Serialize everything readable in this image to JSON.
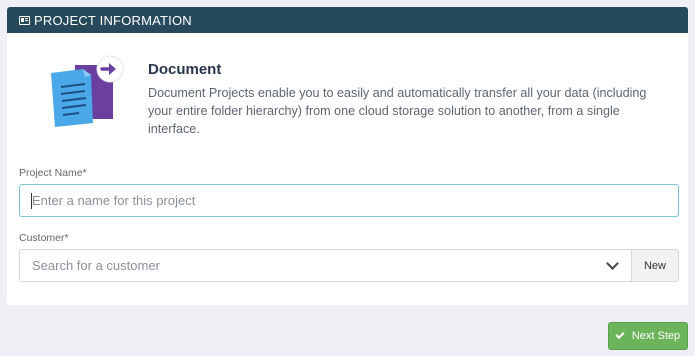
{
  "header": {
    "title": "PROJECT INFORMATION",
    "icon": "id-card-icon"
  },
  "intro": {
    "illustration": "document-transfer-icon",
    "title": "Document",
    "description": "Document Projects enable you to easily and automatically transfer all your data (including your entire folder hierarchy) from one cloud storage solution to another, from a single interface."
  },
  "form": {
    "project_name": {
      "label": "Project Name*",
      "value": "",
      "placeholder": "Enter a name for this project"
    },
    "customer": {
      "label": "Customer*",
      "placeholder": "Search for a customer",
      "new_label": "New"
    }
  },
  "footer": {
    "next_label": "Next Step"
  },
  "colors": {
    "header_bg": "#27495c",
    "page_bg": "#eef0f5",
    "accent_green": "#6cb45a",
    "input_focus_border": "#7ec3d6",
    "doc_blue": "#4aa8e8",
    "doc_purple": "#6a3fa0"
  }
}
